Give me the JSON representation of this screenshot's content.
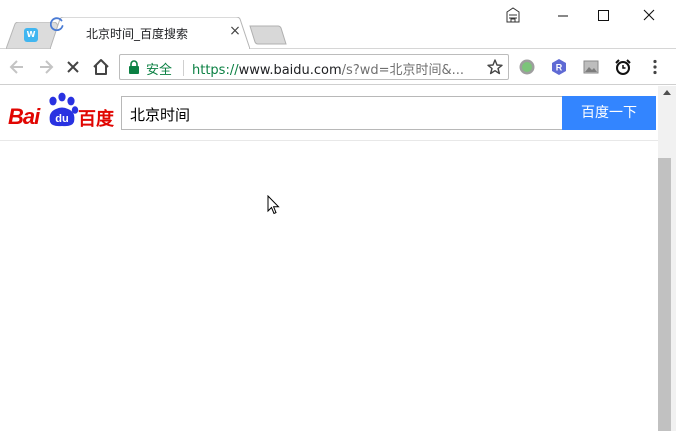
{
  "browser": {
    "tabs": [
      {
        "label": "",
        "icon": "wps-doc-icon",
        "active": false
      },
      {
        "label": "北京时间_百度搜索",
        "icon": "loading-spinner-icon",
        "active": true
      }
    ],
    "close_tab_glyph": "×",
    "omnibox": {
      "security_label": "安全",
      "url_scheme": "https://",
      "url_host": "www.baidu.com",
      "url_path": "/s?wd=北京时间&..."
    },
    "extensions": [
      "circle-extension-icon",
      "hexagon-r-extension-icon",
      "image-extension-icon",
      "alarm-clock-extension-icon"
    ]
  },
  "page": {
    "logo": {
      "text_left": "Bai",
      "paw_text": "du",
      "text_right": "百度"
    },
    "search": {
      "value": "北京时间",
      "button_label": "百度一下"
    }
  },
  "colors": {
    "baidu_red": "#e10602",
    "baidu_blue": "#2932e1",
    "button_blue": "#3385ff",
    "secure_green": "#0b8043"
  }
}
